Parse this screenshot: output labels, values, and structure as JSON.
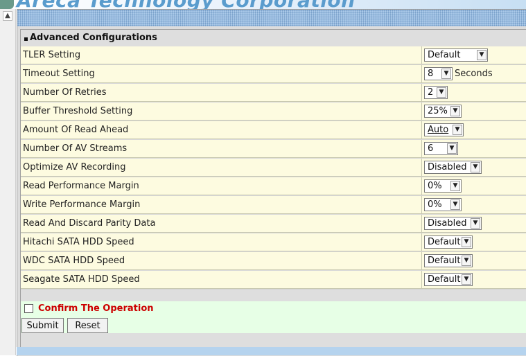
{
  "banner": {
    "title": "Areca Technology Corporation"
  },
  "section": {
    "title": "Advanced Configurations"
  },
  "settings": [
    {
      "label": "TLER Setting",
      "value": "Default"
    },
    {
      "label": "Timeout Setting",
      "value": "8",
      "unit": "Seconds"
    },
    {
      "label": "Number Of Retries",
      "value": "2"
    },
    {
      "label": "Buffer Threshold Setting",
      "value": "25%"
    },
    {
      "label": "Amount Of Read Ahead",
      "value": "Auto"
    },
    {
      "label": "Number Of AV Streams",
      "value": "6"
    },
    {
      "label": "Optimize AV Recording",
      "value": "Disabled"
    },
    {
      "label": "Read Performance Margin",
      "value": "0%"
    },
    {
      "label": "Write Performance Margin",
      "value": "0%"
    },
    {
      "label": "Read And Discard Parity Data",
      "value": "Disabled"
    },
    {
      "label": "Hitachi SATA HDD Speed",
      "value": "Default"
    },
    {
      "label": "WDC SATA HDD Speed",
      "value": "Default"
    },
    {
      "label": "Seagate SATA HDD Speed",
      "value": "Default"
    }
  ],
  "confirm": {
    "label": "Confirm The Operation",
    "checked": false
  },
  "buttons": {
    "submit": "Submit",
    "reset": "Reset"
  },
  "icons": {
    "scroll_up": "chevron-up-icon",
    "dropdown": "chevron-down-icon"
  }
}
